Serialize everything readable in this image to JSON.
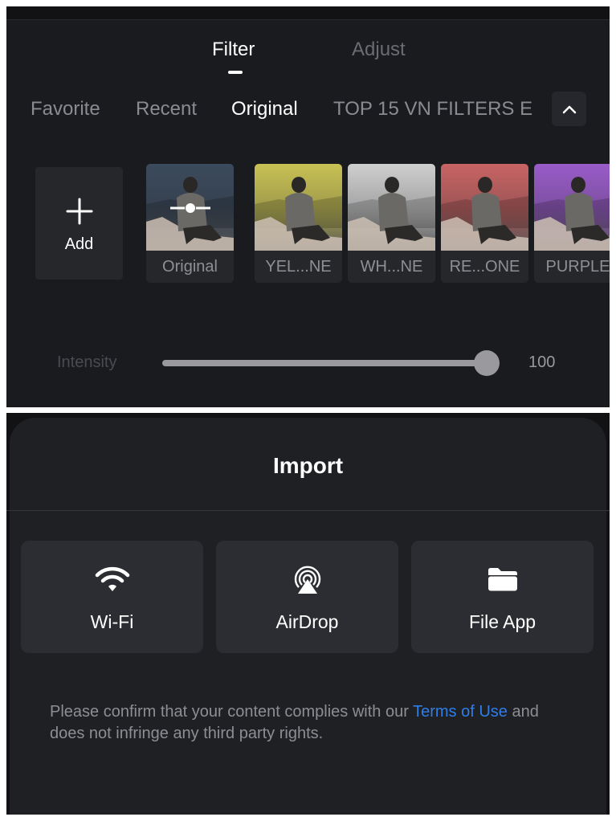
{
  "filter_panel": {
    "mode_tabs": [
      {
        "label": "Filter",
        "active": true
      },
      {
        "label": "Adjust",
        "active": false
      }
    ],
    "categories": [
      {
        "label": "Favorite",
        "active": false
      },
      {
        "label": "Recent",
        "active": false
      },
      {
        "label": "Original",
        "active": true
      },
      {
        "label": "TOP 15 VN FILTERS E",
        "active": false
      }
    ],
    "collapse_icon": "chevron-up-icon",
    "add_label": "Add",
    "filters": [
      {
        "label": "Original",
        "tint": "#3b4a5c",
        "selected": true
      },
      {
        "label": "YEL...NE",
        "tint": "#c9c255"
      },
      {
        "label": "WH...NE",
        "tint": "#cfcfcf"
      },
      {
        "label": "RE...ONE",
        "tint": "#c86464"
      },
      {
        "label": "PURPLE",
        "tint": "#9a5cc9"
      }
    ],
    "intensity": {
      "label": "Intensity",
      "value": 100,
      "max": 100,
      "display": "100"
    }
  },
  "import_sheet": {
    "title": "Import",
    "options": [
      {
        "label": "Wi-Fi",
        "icon": "wifi-icon"
      },
      {
        "label": "AirDrop",
        "icon": "airdrop-icon"
      },
      {
        "label": "File App",
        "icon": "folder-icon"
      }
    ],
    "notice_prefix": "Please confirm that your content complies with our ",
    "notice_link": "Terms of Use",
    "notice_suffix": " and does not infringe any third party rights."
  },
  "colors": {
    "link": "#2f7ee8",
    "panel_bg": "#1a1b1f",
    "card_bg": "#26272b"
  }
}
